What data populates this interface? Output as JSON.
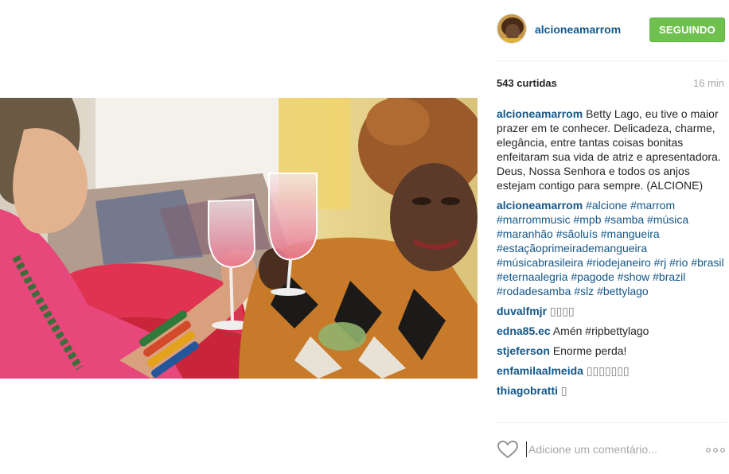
{
  "post": {
    "username": "alcioneamarrom",
    "follow_label": "SEGUINDO",
    "likes": "543 curtidas",
    "time": "16 min"
  },
  "comments": [
    {
      "user": "alcioneamarrom",
      "text": "Betty Lago, eu tive o maior prazer em te conhecer. Delicadeza, charme, elegância, entre tantas coisas bonitas enfeitaram sua vida de atriz e apresentadora. Deus, Nossa Senhora e todos os anjos estejam contigo para sempre. (ALCIONE)"
    },
    {
      "user": "alcioneamarrom",
      "text": "#alcione #marrom #marrommusic #mpb #samba #música #maranhão #sãoluís #mangueira #estaçãoprimeirademangueira #músicabrasileira #riodejaneiro #rj #rio #brasil #eternaalegria #pagode #show #brazil #rodadesamba #slz #bettylago"
    },
    {
      "user": "duvalfmjr",
      "text": ""
    },
    {
      "user": "edna85.ec",
      "text": "Amén #ripbettylago"
    },
    {
      "user": "stjeferson",
      "text": "Enorme perda!"
    },
    {
      "user": "enfamilaalmeida",
      "text": ""
    },
    {
      "user": "thiagobratti",
      "text": ""
    }
  ],
  "comment_box": {
    "placeholder": "Adicione um comentário..."
  },
  "icons": {
    "like": "heart-outline-icon",
    "more": "more-options-icon"
  },
  "colors": {
    "link": "#125688",
    "follow_button": "#70c050",
    "muted": "#a5a7aa"
  }
}
